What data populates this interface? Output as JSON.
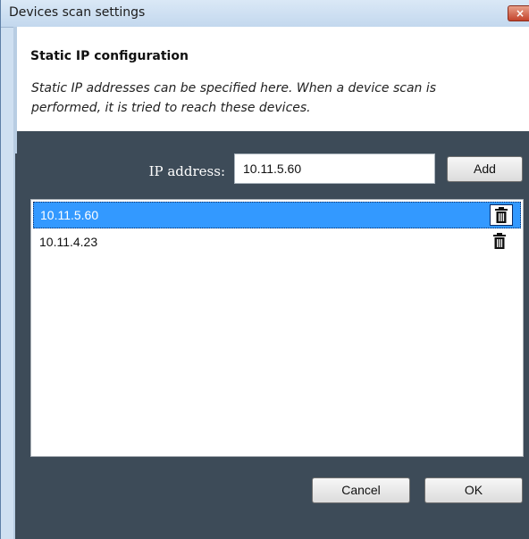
{
  "window": {
    "title": "Devices scan settings",
    "close_glyph": "×"
  },
  "header": {
    "title": "Static IP configuration",
    "description": "Static IP addresses can be specified here. When a device scan is performed, it is tried to reach these devices."
  },
  "ip_entry": {
    "label": "IP address:",
    "value": "10.11.5.60",
    "add_label": "Add"
  },
  "ip_list": {
    "items": [
      {
        "address": "10.11.5.60",
        "selected": true,
        "icon": "trash-icon"
      },
      {
        "address": "10.11.4.23",
        "selected": false,
        "icon": "trash-icon"
      }
    ]
  },
  "footer": {
    "cancel_label": "Cancel",
    "ok_label": "OK"
  },
  "colors": {
    "selection": "#3399ff",
    "content_background": "#3d4b58",
    "titlebar": "#c3d8ee"
  }
}
